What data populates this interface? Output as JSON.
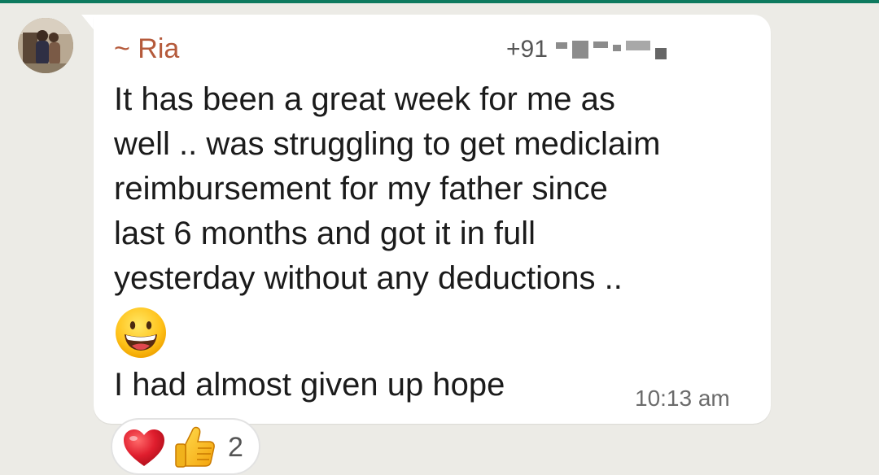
{
  "sender": {
    "name": "~ Ria",
    "phone_prefix": "+91"
  },
  "message": {
    "lines": [
      "It has been a great week for me as",
      "well .. was struggling to get mediclaim",
      "reimbursement for my father since",
      "last 6 months and got it in full",
      "yesterday without any deductions .."
    ],
    "emoji": "grinning-face",
    "closing_line": "I had almost given up hope",
    "time": "10:13 am"
  },
  "reactions": {
    "items": [
      "red-heart",
      "thumbs-up"
    ],
    "count": "2"
  },
  "colors": {
    "header_bar": "#0e7a5f",
    "background": "#ecebe6",
    "bubble": "#ffffff",
    "sender_name": "#b55a3b",
    "text": "#1b1b1b",
    "timestamp": "#6b6b6b"
  }
}
